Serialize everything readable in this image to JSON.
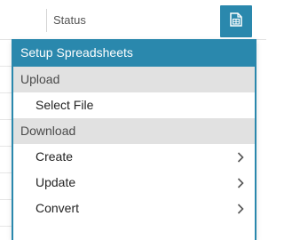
{
  "table": {
    "column_header": "Status"
  },
  "toolbar": {
    "sheet_icon": "spreadsheet-icon"
  },
  "menu": {
    "title": "Setup Spreadsheets",
    "sections": [
      {
        "label": "Upload",
        "items": [
          {
            "label": "Select File",
            "has_submenu": false
          }
        ]
      },
      {
        "label": "Download",
        "items": [
          {
            "label": "Create",
            "has_submenu": true
          },
          {
            "label": "Update",
            "has_submenu": true
          },
          {
            "label": "Convert",
            "has_submenu": true
          }
        ]
      }
    ]
  },
  "colors": {
    "accent": "#2a88ad",
    "section_bg": "#e1e1e1"
  }
}
